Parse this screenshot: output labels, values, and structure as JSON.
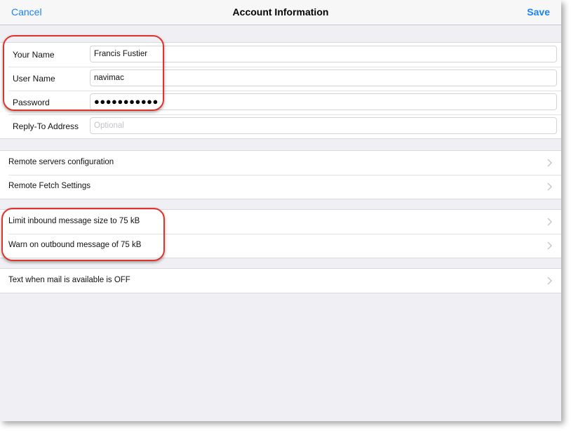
{
  "navbar": {
    "cancel_label": "Cancel",
    "title": "Account Information",
    "save_label": "Save"
  },
  "account_fields": [
    {
      "label": "Your Name",
      "value": "Francis Fustier",
      "placeholder": ""
    },
    {
      "label": "User Name",
      "value": "navimac",
      "placeholder": ""
    },
    {
      "label": "Password",
      "value": "●●●●●●●●●●●",
      "placeholder": ""
    },
    {
      "label": "Reply-To Address",
      "value": "",
      "placeholder": "Optional"
    }
  ],
  "server_settings": [
    {
      "label": "Remote servers configuration"
    },
    {
      "label": "Remote Fetch Settings"
    }
  ],
  "message_limits": [
    {
      "label": "Limit inbound message size to 75 kB"
    },
    {
      "label": "Warn on outbound message of 75 kB"
    }
  ],
  "notifications": [
    {
      "label": "Text when mail is available is OFF"
    }
  ],
  "colors": {
    "accent": "#1a82f7",
    "highlight_annotation": "#e0332c",
    "background": "#efeff4"
  },
  "icons": {
    "disclosure": "chevron-right-icon"
  }
}
